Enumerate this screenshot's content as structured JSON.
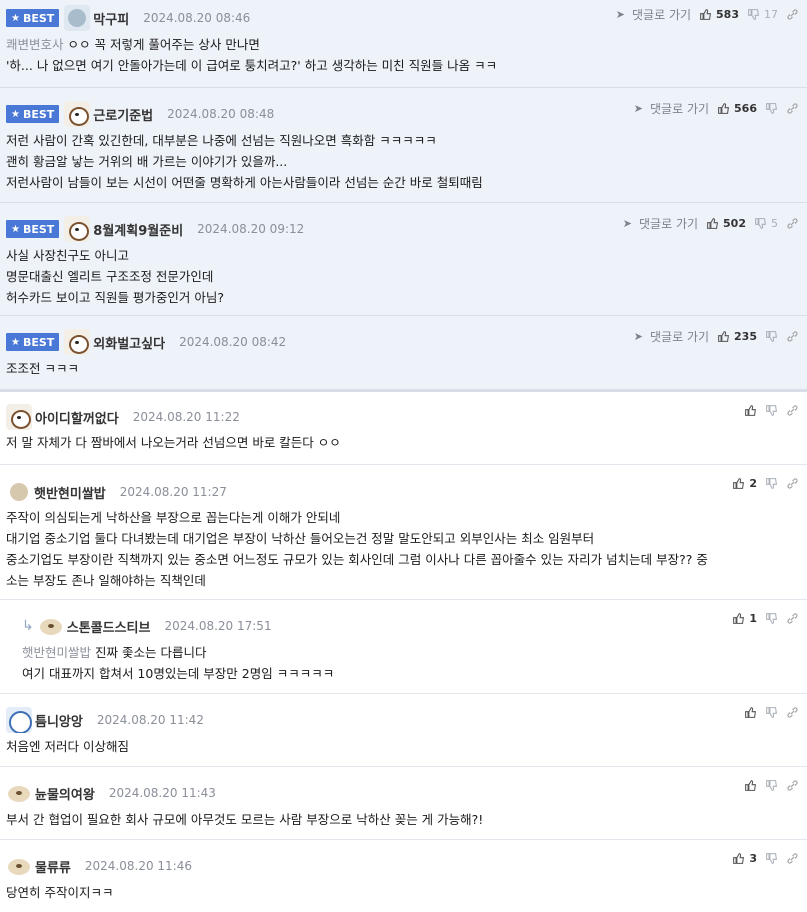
{
  "best_label": "BEST",
  "reply_label": "댓글로 가기",
  "comments": [
    {
      "nick": "막구피",
      "date": "2024.08.20 08:46",
      "up": "583",
      "down": "17",
      "mention": "쾌변변호사",
      "lines": [
        "ㅇㅇ 꼭 저렇게 풀어주는 상사 만나면",
        "'하... 나 없으면 여기 안돌아가는데 이 급여로 퉁치려고?' 하고 생각하는 미친 직원들 나옴 ㅋㅋ"
      ]
    },
    {
      "nick": "근로기준법",
      "date": "2024.08.20 08:48",
      "up": "566",
      "down": "",
      "lines": [
        "저런 사람이 간혹 있긴한데, 대부분은 나중에 선넘는 직원나오면 흑화함 ㅋㅋㅋㅋㅋ",
        "괜히 황금알 낳는 거위의 배 가르는 이야기가 있을까...",
        "저런사람이 남들이 보는 시선이 어떤줄 명확하게 아는사람들이라 선넘는 순간 바로 철퇴때림"
      ]
    },
    {
      "nick": "8월계획9월준비",
      "date": "2024.08.20 09:12",
      "up": "502",
      "down": "5",
      "lines": [
        "사실 사장친구도 아니고",
        "명문대출신 엘리트 구조조정 전문가인데",
        "허수카드 보이고 직원들 평가중인거 아님?"
      ]
    },
    {
      "nick": "외화벌고싶다",
      "date": "2024.08.20 08:42",
      "up": "235",
      "down": "",
      "lines": [
        "조조전 ㅋㅋㅋ"
      ]
    },
    {
      "nick": "아이디할꺼없다",
      "date": "2024.08.20 11:22",
      "up": "",
      "lines": [
        "저 말 자체가 다 짬바에서 나오는거라 선넘으면 바로 칼든다 ㅇㅇ"
      ]
    },
    {
      "nick": "햇반현미쌀밥",
      "date": "2024.08.20 11:27",
      "up": "2",
      "lines": [
        "주작이 의심되는게 낙하산을 부장으로 꼽는다는게 이해가 안되네",
        "대기업 중소기업 둘다 다녀봤는데 대기업은 부장이 낙하산 들어오는건 정말 말도안되고 외부인사는 최소 임원부터",
        "중소기업도 부장이란 직책까지 있는 중소면 어느정도 규모가 있는 회사인데 그럼 이사나 다른 꼽아줄수 있는 자리가 넘치는데 부장?? 중",
        "소는 부장도 존나 일해야하는 직책인데"
      ]
    },
    {
      "nick": "스톤콜드스티브",
      "date": "2024.08.20 17:51",
      "up": "1",
      "mention": "햇반현미쌀밥",
      "lines": [
        "진짜 좇소는 다릅니다",
        "여기 대표까지 합쳐서 10명있는데 부장만 2명임 ㅋㅋㅋㅋㅋ"
      ]
    },
    {
      "nick": "틈니앙앙",
      "date": "2024.08.20 11:42",
      "up": "",
      "lines": [
        "처음엔 저러다 이상해짐"
      ]
    },
    {
      "nick": "뉸물의여왕",
      "date": "2024.08.20 11:43",
      "up": "",
      "lines": [
        "부서 간 협업이 필요한 회사 규모에 아무것도 모르는 사람 부장으로 낙하산 꽂는 게 가능해?!"
      ]
    },
    {
      "nick": "물류류",
      "date": "2024.08.20 11:46",
      "up": "3",
      "lines": [
        "당연히 주작이지ㅋㅋ"
      ]
    }
  ]
}
